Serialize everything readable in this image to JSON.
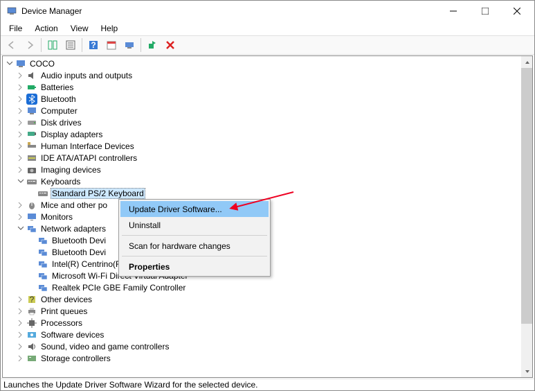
{
  "window": {
    "title": "Device Manager"
  },
  "menu": {
    "file": "File",
    "action": "Action",
    "view": "View",
    "help": "Help"
  },
  "tree": {
    "root": "COCO",
    "cat": {
      "audio": "Audio inputs and outputs",
      "batteries": "Batteries",
      "bluetooth": "Bluetooth",
      "computer": "Computer",
      "disk": "Disk drives",
      "display": "Display adapters",
      "hid": "Human Interface Devices",
      "ide": "IDE ATA/ATAPI controllers",
      "imaging": "Imaging devices",
      "keyboards": "Keyboards",
      "mice": "Mice and other po",
      "monitors": "Monitors",
      "network": "Network adapters",
      "other": "Other devices",
      "print": "Print queues",
      "processors": "Processors",
      "software": "Software devices",
      "sound": "Sound, video and game controllers",
      "storage": "Storage controllers"
    },
    "kb_child": "Standard PS/2 Keyboard",
    "net": {
      "n1": "Bluetooth Devi",
      "n2": "Bluetooth Devi",
      "n3": "Intel(R) Centrino(R) Advanced-N 6235",
      "n4": "Microsoft Wi-Fi Direct Virtual Adapter",
      "n5": "Realtek PCIe GBE Family Controller"
    }
  },
  "context": {
    "update": "Update Driver Software...",
    "uninstall": "Uninstall",
    "scan": "Scan for hardware changes",
    "properties": "Properties"
  },
  "status": "Launches the Update Driver Software Wizard for the selected device."
}
